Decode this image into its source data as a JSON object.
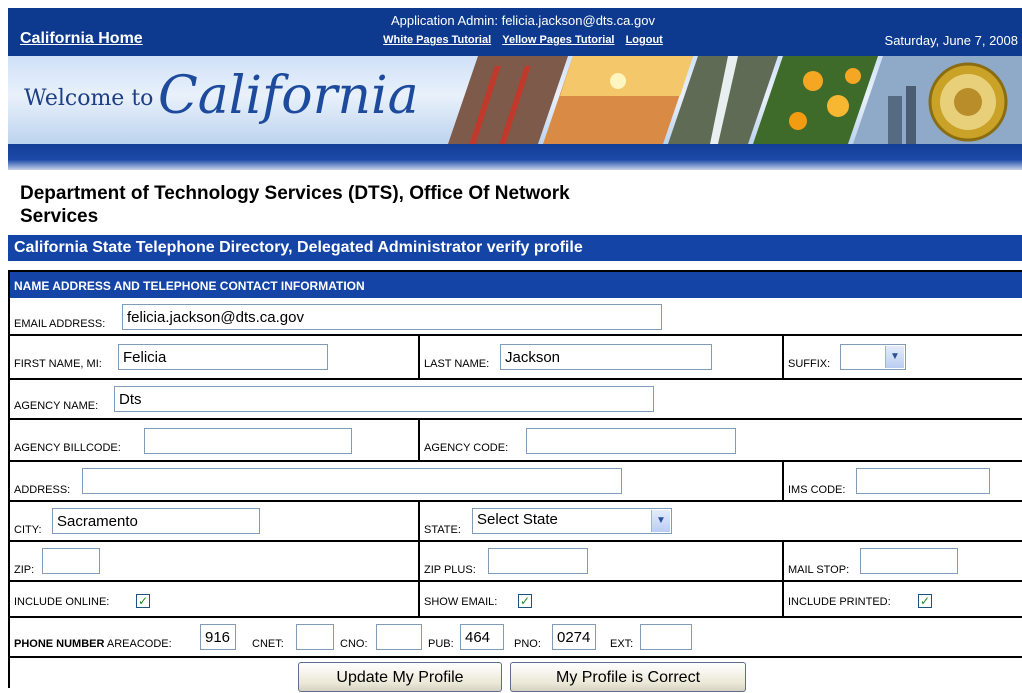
{
  "header": {
    "home_link": "California Home",
    "admin_info": "Application Admin: felicia.jackson@dts.ca.gov",
    "links": [
      "White Pages Tutorial",
      "Yellow Pages Tutorial",
      "Logout"
    ],
    "date": "Saturday, June 7, 2008"
  },
  "banner": {
    "welcome_to": "Welcome to",
    "california": "California"
  },
  "page": {
    "department_title": "Department of Technology Services (DTS), Office Of Network Services",
    "section_title": "California State Telephone Directory, Delegated Administrator verify profile",
    "form_header": "NAME ADDRESS AND TELEPHONE CONTACT INFORMATION"
  },
  "form": {
    "email": {
      "label": "EMAIL ADDRESS:",
      "value": "felicia.jackson@dts.ca.gov"
    },
    "first_name": {
      "label": "FIRST NAME, MI:",
      "value": "Felicia"
    },
    "last_name": {
      "label": "LAST NAME:",
      "value": "Jackson"
    },
    "suffix": {
      "label": "SUFFIX:",
      "value": ""
    },
    "agency_name": {
      "label": "AGENCY NAME:",
      "value": "Dts"
    },
    "agency_billcode": {
      "label": "AGENCY BILLCODE:",
      "value": ""
    },
    "agency_code": {
      "label": "AGENCY CODE:",
      "value": ""
    },
    "address": {
      "label": "ADDRESS:",
      "value": ""
    },
    "ims_code": {
      "label": "IMS CODE:",
      "value": ""
    },
    "city": {
      "label": "CITY:",
      "value": "Sacramento"
    },
    "state": {
      "label": "STATE:",
      "value": "Select State"
    },
    "zip": {
      "label": "ZIP:",
      "value": ""
    },
    "zip_plus": {
      "label": "ZIP PLUS:",
      "value": ""
    },
    "mail_stop": {
      "label": "MAIL STOP:",
      "value": ""
    },
    "include_online": {
      "label": "INCLUDE ONLINE:",
      "checked": true
    },
    "show_email": {
      "label": "SHOW EMAIL:",
      "checked": true
    },
    "include_printed": {
      "label": "INCLUDE PRINTED:",
      "checked": true
    },
    "phone": {
      "label_bold": "PHONE NUMBER",
      "areacode": {
        "label": "AREACODE:",
        "value": "916"
      },
      "cnet": {
        "label": "CNET:",
        "value": ""
      },
      "cno": {
        "label": "CNO:",
        "value": ""
      },
      "pub": {
        "label": "PUB:",
        "value": "464"
      },
      "pno": {
        "label": "PNO:",
        "value": "0274"
      },
      "ext": {
        "label": "EXT:",
        "value": ""
      }
    }
  },
  "buttons": {
    "update": "Update My Profile",
    "correct": "My Profile is Correct"
  },
  "colors": {
    "header_blue": "#0d3a8f",
    "section_blue": "#1444a6",
    "check_green": "#1e8c1e"
  }
}
